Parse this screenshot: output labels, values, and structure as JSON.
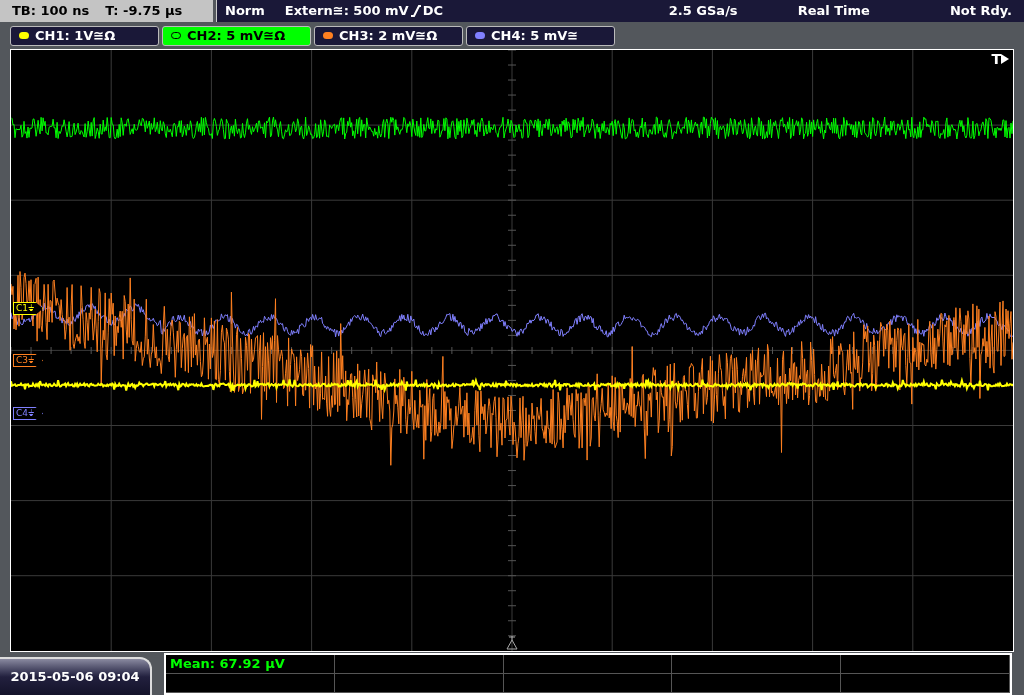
{
  "status_bar": {
    "timebase": "TB: 100 ns",
    "trigger_time": "T: -9.75 µs",
    "mode": "Norm",
    "trigger_source": "Extern≅: 500 mV",
    "trigger_coupling": "DC",
    "sample_rate": "2.5 GSa/s",
    "acquisition": "Real Time",
    "state": "Not Rdy."
  },
  "channels": [
    {
      "label": "CH1: 1V≅Ω",
      "color": "#ffff00",
      "selected": false
    },
    {
      "label": "CH2: 5 mV≅Ω",
      "color": "#00ff00",
      "selected": true
    },
    {
      "label": "CH3: 2 mV≅Ω",
      "color": "#ff8020",
      "selected": false
    },
    {
      "label": "CH4: 5 mV≅",
      "color": "#8080ff",
      "selected": false
    }
  ],
  "trigger_marker": "T",
  "channel_markers": [
    {
      "label": "C1⏚",
      "color": "#ffff00"
    },
    {
      "label": "C3⏚",
      "color": "#ff8020"
    },
    {
      "label": "C4⏚",
      "color": "#8080ff"
    }
  ],
  "datetime": "2015-05-06 09:04",
  "measurements": [
    {
      "text": "Mean: 67.92 µV"
    }
  ]
}
